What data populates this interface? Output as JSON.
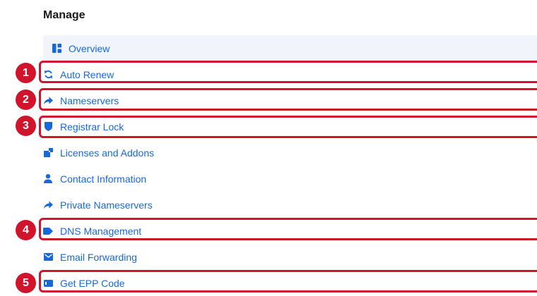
{
  "section": {
    "title": "Manage"
  },
  "colors": {
    "link": "#1769d9",
    "highlight": "#d0142c",
    "active_bg": "#f1f5fb"
  },
  "menu": {
    "items": [
      {
        "label": "Overview",
        "icon": "dashboard-icon",
        "active": true
      },
      {
        "label": "Auto Renew",
        "icon": "sync-icon"
      },
      {
        "label": "Nameservers",
        "icon": "share-arrow-icon"
      },
      {
        "label": "Registrar Lock",
        "icon": "shield-icon"
      },
      {
        "label": "Licenses and Addons",
        "icon": "addons-icon"
      },
      {
        "label": "Contact Information",
        "icon": "person-icon"
      },
      {
        "label": "Private Nameservers",
        "icon": "share-arrow-icon"
      },
      {
        "label": "DNS Management",
        "icon": "tag-icon"
      },
      {
        "label": "Email Forwarding",
        "icon": "envelope-icon"
      },
      {
        "label": "Get EPP Code",
        "icon": "card-icon"
      }
    ]
  },
  "annotations": {
    "badges": [
      "1",
      "2",
      "3",
      "4",
      "5"
    ]
  }
}
